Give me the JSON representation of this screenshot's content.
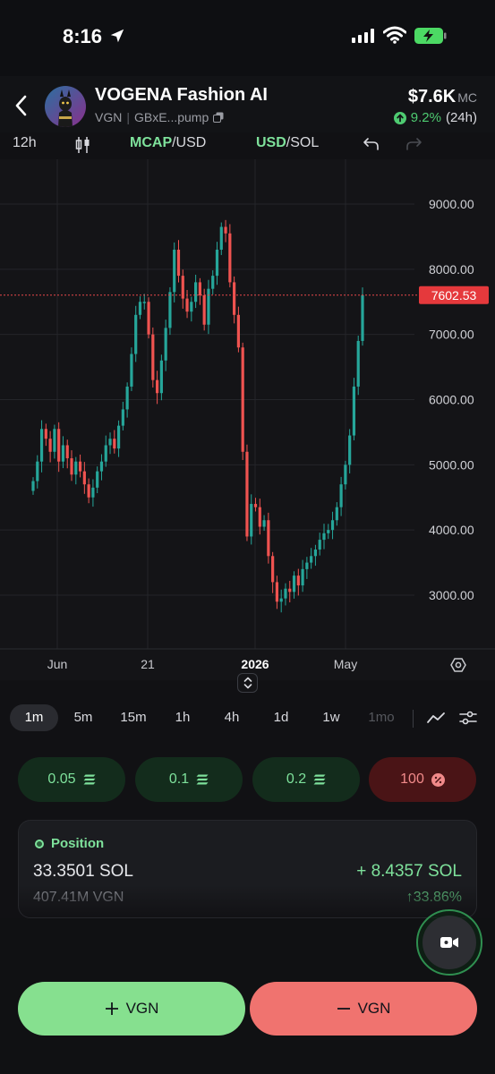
{
  "status_bar": {
    "time": "8:16"
  },
  "header": {
    "token_name": "VOGENA Fashion AI",
    "ticker": "VGN",
    "address": "GBxE...pump",
    "market_cap": "$7.6K",
    "market_cap_label": "MC",
    "change_pct": "9.2%",
    "change_period": "(24h)",
    "change_color": "#4ecb71"
  },
  "chart_toolbar": {
    "interval": "12h",
    "mcap_highlight": "MCAP",
    "mcap_rest": "/USD",
    "usd_highlight": "USD",
    "usd_rest": "/SOL"
  },
  "chart_data": {
    "type": "candlestick",
    "price_axis_ticks": [
      "9000.00",
      "8000.00",
      "7000.00",
      "6000.00",
      "5000.00",
      "4000.00",
      "3000.00"
    ],
    "time_axis_ticks": [
      "Jun",
      "21",
      "2026",
      "May"
    ],
    "current_value": "7602.53",
    "current_value_num": 7602.53,
    "ylim": [
      2500,
      9400
    ],
    "up_color": "#26a69a",
    "down_color": "#ef5350",
    "close_series": [
      4750,
      5050,
      5550,
      5400,
      5200,
      5550,
      5050,
      5300,
      5100,
      4850,
      5050,
      4900,
      4700,
      4500,
      4650,
      4900,
      5050,
      5300,
      5400,
      5250,
      5600,
      5850,
      6200,
      6700,
      7300,
      7500,
      7500,
      7000,
      6300,
      6100,
      6600,
      7100,
      7650,
      8300,
      7900,
      7550,
      7350,
      7500,
      7800,
      7600,
      7150,
      7700,
      7900,
      8300,
      8650,
      8550,
      7800,
      7300,
      6800,
      5200,
      3900,
      4400,
      4350,
      4050,
      4150,
      3600,
      3200,
      2900,
      2950,
      3100,
      3050,
      3300,
      3150,
      3400,
      3500,
      3600,
      3700,
      3850,
      3950,
      4000,
      4150,
      4350,
      4700,
      5000,
      5450,
      6200,
      6900,
      7602
    ]
  },
  "expand_handle": {
    "icon": "expand-vertical-icon"
  },
  "intervals": [
    {
      "label": "1m",
      "active": true
    },
    {
      "label": "5m"
    },
    {
      "label": "15m"
    },
    {
      "label": "1h"
    },
    {
      "label": "4h"
    },
    {
      "label": "1d"
    },
    {
      "label": "1w"
    },
    {
      "label": "1mo",
      "disabled": true
    }
  ],
  "quick_buy": [
    {
      "label": "0.05"
    },
    {
      "label": "0.1"
    },
    {
      "label": "0.2"
    },
    {
      "label": "100"
    }
  ],
  "position": {
    "title": "Position",
    "sol_amount": "33.3501 SOL",
    "pnl_sol": "+ 8.4357 SOL",
    "token_amount": "407.41M VGN",
    "pnl_pct": "↑33.86%"
  },
  "actions": {
    "buy_label": "VGN",
    "sell_label": "VGN",
    "buy_color": "#86e08f",
    "sell_color": "#f0736f"
  }
}
